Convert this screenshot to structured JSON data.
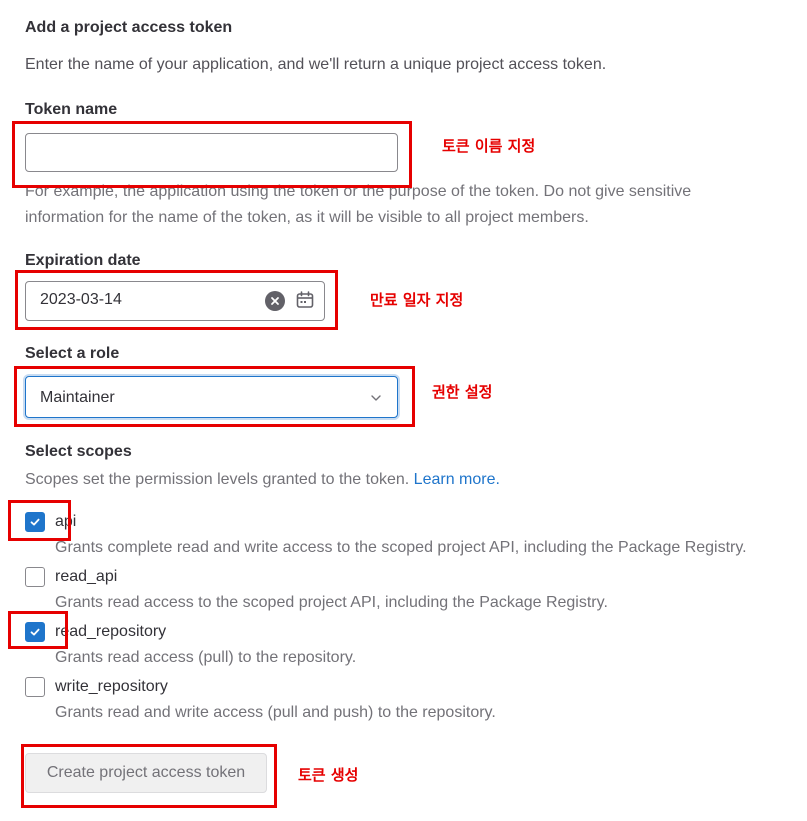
{
  "form": {
    "title": "Add a project access token",
    "description": "Enter the name of your application, and we'll return a unique project access token.",
    "token_name": {
      "label": "Token name",
      "value": "",
      "help_line1": "For example, the application using the token or the purpose of the token. Do not give sensitive",
      "help_line2": "information for the name of the token, as it will be visible to all project members."
    },
    "expiration": {
      "label": "Expiration date",
      "value": "2023-03-14"
    },
    "role": {
      "label": "Select a role",
      "value": "Maintainer"
    },
    "scopes": {
      "label": "Select scopes",
      "description": "Scopes set the permission levels granted to the token.",
      "learn_more": "Learn more.",
      "items": [
        {
          "name": "api",
          "checked": true,
          "description": "Grants complete read and write access to the scoped project API, including the Package Registry."
        },
        {
          "name": "read_api",
          "checked": false,
          "description": "Grants read access to the scoped project API, including the Package Registry."
        },
        {
          "name": "read_repository",
          "checked": true,
          "description": "Grants read access (pull) to the repository."
        },
        {
          "name": "write_repository",
          "checked": false,
          "description": "Grants read and write access (pull and push) to the repository."
        }
      ]
    },
    "submit_label": "Create project access token"
  },
  "annotations": {
    "token_name": "토큰 이름 지정",
    "expiration": "만료 일자 지정",
    "role": "권한 설정",
    "create": "토큰 생성"
  },
  "colors": {
    "accent": "#1f75cb",
    "annotation_red": "#e60000"
  }
}
